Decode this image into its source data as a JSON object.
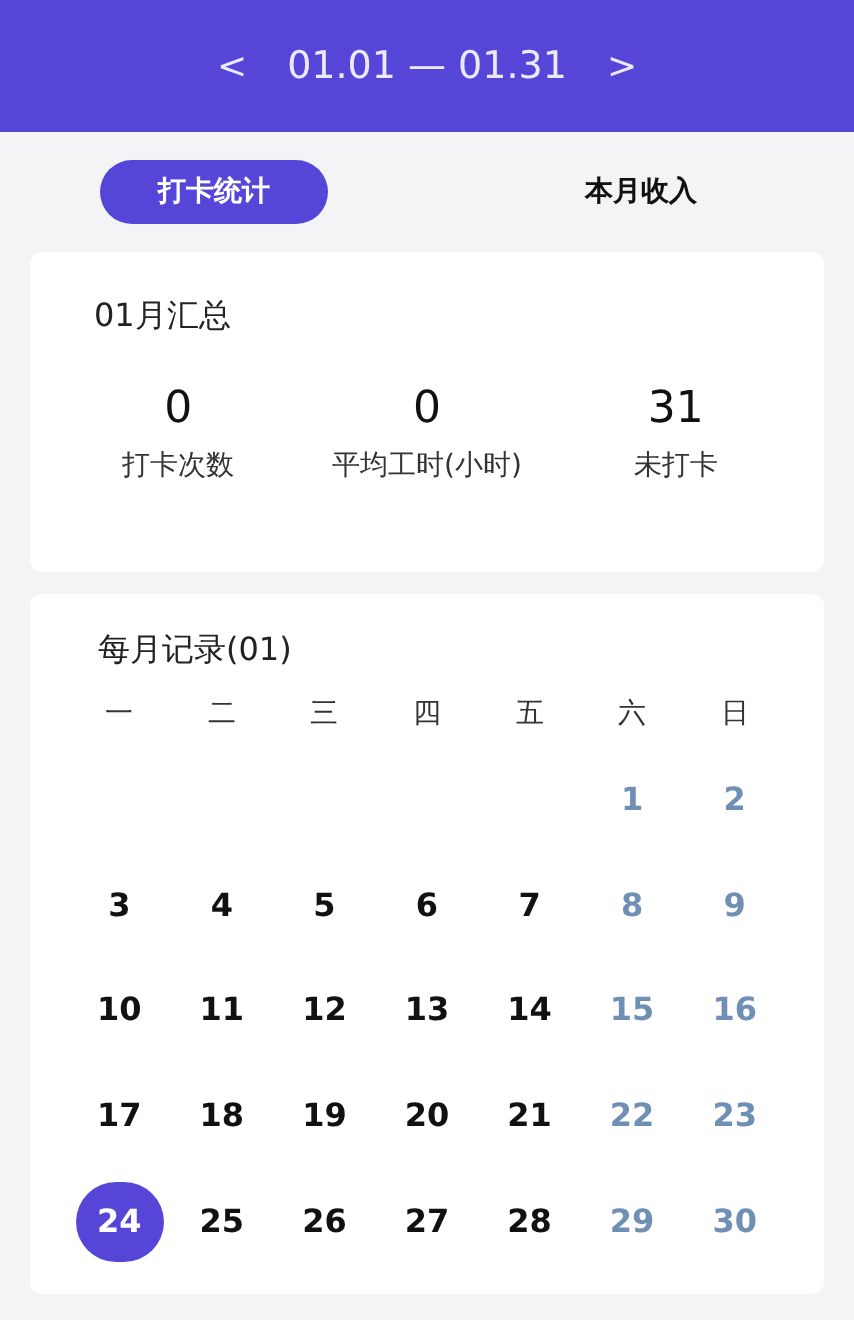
{
  "header": {
    "prev": "<",
    "range": "01.01 — 01.31",
    "next": ">"
  },
  "tabs": [
    {
      "label": "打卡统计",
      "selected": true
    },
    {
      "label": "本月收入",
      "selected": false
    }
  ],
  "summary": {
    "title": "01月汇总",
    "stats": [
      {
        "value": "0",
        "label": "打卡次数"
      },
      {
        "value": "0",
        "label": "平均工时(小时)"
      },
      {
        "value": "31",
        "label": "未打卡"
      }
    ]
  },
  "calendar": {
    "title": "每月记录(01)",
    "weekdays": [
      "一",
      "二",
      "三",
      "四",
      "五",
      "六",
      "日"
    ],
    "days": [
      {
        "kind": "empty"
      },
      {
        "kind": "empty"
      },
      {
        "kind": "empty"
      },
      {
        "kind": "empty"
      },
      {
        "kind": "empty"
      },
      {
        "kind": "day",
        "label": "1",
        "weekend": true,
        "selected": false
      },
      {
        "kind": "day",
        "label": "2",
        "weekend": true,
        "selected": false
      },
      {
        "kind": "day",
        "label": "3",
        "weekend": false,
        "selected": false
      },
      {
        "kind": "day",
        "label": "4",
        "weekend": false,
        "selected": false
      },
      {
        "kind": "day",
        "label": "5",
        "weekend": false,
        "selected": false
      },
      {
        "kind": "day",
        "label": "6",
        "weekend": false,
        "selected": false
      },
      {
        "kind": "day",
        "label": "7",
        "weekend": false,
        "selected": false
      },
      {
        "kind": "day",
        "label": "8",
        "weekend": true,
        "selected": false
      },
      {
        "kind": "day",
        "label": "9",
        "weekend": true,
        "selected": false
      },
      {
        "kind": "day",
        "label": "10",
        "weekend": false,
        "selected": false
      },
      {
        "kind": "day",
        "label": "11",
        "weekend": false,
        "selected": false
      },
      {
        "kind": "day",
        "label": "12",
        "weekend": false,
        "selected": false
      },
      {
        "kind": "day",
        "label": "13",
        "weekend": false,
        "selected": false
      },
      {
        "kind": "day",
        "label": "14",
        "weekend": false,
        "selected": false
      },
      {
        "kind": "day",
        "label": "15",
        "weekend": true,
        "selected": false
      },
      {
        "kind": "day",
        "label": "16",
        "weekend": true,
        "selected": false
      },
      {
        "kind": "day",
        "label": "17",
        "weekend": false,
        "selected": false
      },
      {
        "kind": "day",
        "label": "18",
        "weekend": false,
        "selected": false
      },
      {
        "kind": "day",
        "label": "19",
        "weekend": false,
        "selected": false
      },
      {
        "kind": "day",
        "label": "20",
        "weekend": false,
        "selected": false
      },
      {
        "kind": "day",
        "label": "21",
        "weekend": false,
        "selected": false
      },
      {
        "kind": "day",
        "label": "22",
        "weekend": true,
        "selected": false
      },
      {
        "kind": "day",
        "label": "23",
        "weekend": true,
        "selected": false
      },
      {
        "kind": "day",
        "label": "24",
        "weekend": false,
        "selected": true
      },
      {
        "kind": "day",
        "label": "25",
        "weekend": false,
        "selected": false
      },
      {
        "kind": "day",
        "label": "26",
        "weekend": false,
        "selected": false
      },
      {
        "kind": "day",
        "label": "27",
        "weekend": false,
        "selected": false
      },
      {
        "kind": "day",
        "label": "28",
        "weekend": false,
        "selected": false
      },
      {
        "kind": "day",
        "label": "29",
        "weekend": true,
        "selected": false
      },
      {
        "kind": "day",
        "label": "30",
        "weekend": true,
        "selected": false
      }
    ]
  }
}
